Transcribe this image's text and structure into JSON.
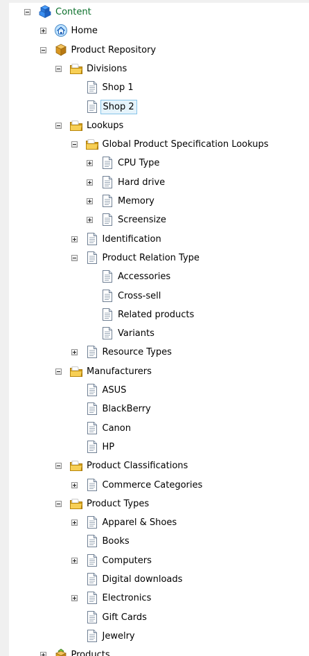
{
  "tree": {
    "nodes": [
      {
        "label": "Content",
        "depth": 0,
        "expander": "minus",
        "icon": "content-icon",
        "highlight": "green",
        "selected": false
      },
      {
        "label": "Home",
        "depth": 1,
        "expander": "plus",
        "icon": "home-icon",
        "selected": false
      },
      {
        "label": "Product Repository",
        "depth": 1,
        "expander": "minus",
        "icon": "box-icon",
        "selected": false
      },
      {
        "label": "Divisions",
        "depth": 2,
        "expander": "minus",
        "icon": "folder-icon",
        "selected": false
      },
      {
        "label": "Shop 1",
        "depth": 3,
        "expander": "none",
        "icon": "document-icon",
        "selected": false
      },
      {
        "label": "Shop 2",
        "depth": 3,
        "expander": "none",
        "icon": "document-icon",
        "selected": true
      },
      {
        "label": "Lookups",
        "depth": 2,
        "expander": "minus",
        "icon": "folder-icon",
        "selected": false
      },
      {
        "label": "Global Product Specification Lookups",
        "depth": 3,
        "expander": "minus",
        "icon": "folder-icon",
        "selected": false
      },
      {
        "label": "CPU Type",
        "depth": 4,
        "expander": "plus",
        "icon": "document-icon",
        "selected": false
      },
      {
        "label": "Hard drive",
        "depth": 4,
        "expander": "plus",
        "icon": "document-icon",
        "selected": false
      },
      {
        "label": "Memory",
        "depth": 4,
        "expander": "plus",
        "icon": "document-icon",
        "selected": false
      },
      {
        "label": "Screensize",
        "depth": 4,
        "expander": "plus",
        "icon": "document-icon",
        "selected": false
      },
      {
        "label": "Identification",
        "depth": 3,
        "expander": "plus",
        "icon": "document-icon",
        "selected": false
      },
      {
        "label": "Product Relation Type",
        "depth": 3,
        "expander": "minus",
        "icon": "document-icon",
        "selected": false
      },
      {
        "label": "Accessories",
        "depth": 4,
        "expander": "none",
        "icon": "document-icon",
        "selected": false
      },
      {
        "label": "Cross-sell",
        "depth": 4,
        "expander": "none",
        "icon": "document-icon",
        "selected": false
      },
      {
        "label": "Related products",
        "depth": 4,
        "expander": "none",
        "icon": "document-icon",
        "selected": false
      },
      {
        "label": "Variants",
        "depth": 4,
        "expander": "none",
        "icon": "document-icon",
        "selected": false
      },
      {
        "label": "Resource Types",
        "depth": 3,
        "expander": "plus",
        "icon": "document-icon",
        "selected": false
      },
      {
        "label": "Manufacturers",
        "depth": 2,
        "expander": "minus",
        "icon": "folder-icon",
        "selected": false
      },
      {
        "label": "ASUS",
        "depth": 3,
        "expander": "none",
        "icon": "document-icon",
        "selected": false
      },
      {
        "label": "BlackBerry",
        "depth": 3,
        "expander": "none",
        "icon": "document-icon",
        "selected": false
      },
      {
        "label": "Canon",
        "depth": 3,
        "expander": "none",
        "icon": "document-icon",
        "selected": false
      },
      {
        "label": "HP",
        "depth": 3,
        "expander": "none",
        "icon": "document-icon",
        "selected": false
      },
      {
        "label": "Product Classifications",
        "depth": 2,
        "expander": "minus",
        "icon": "folder-icon",
        "selected": false
      },
      {
        "label": "Commerce Categories",
        "depth": 3,
        "expander": "plus",
        "icon": "document-icon",
        "selected": false
      },
      {
        "label": "Product Types",
        "depth": 2,
        "expander": "minus",
        "icon": "folder-icon",
        "selected": false
      },
      {
        "label": "Apparel & Shoes",
        "depth": 3,
        "expander": "plus",
        "icon": "document-icon",
        "selected": false
      },
      {
        "label": "Books",
        "depth": 3,
        "expander": "none",
        "icon": "document-icon",
        "selected": false
      },
      {
        "label": "Computers",
        "depth": 3,
        "expander": "plus",
        "icon": "document-icon",
        "selected": false
      },
      {
        "label": "Digital downloads",
        "depth": 3,
        "expander": "none",
        "icon": "document-icon",
        "selected": false
      },
      {
        "label": "Electronics",
        "depth": 3,
        "expander": "plus",
        "icon": "document-icon",
        "selected": false
      },
      {
        "label": "Gift Cards",
        "depth": 3,
        "expander": "none",
        "icon": "document-icon",
        "selected": false
      },
      {
        "label": "Jewelry",
        "depth": 3,
        "expander": "none",
        "icon": "document-icon",
        "selected": false
      },
      {
        "label": "Products",
        "depth": 1,
        "expander": "plus",
        "icon": "products-icon",
        "selected": false
      }
    ]
  },
  "colors": {
    "selection_bg": "#e5f3fb",
    "selection_border": "#86c4e8",
    "content_label": "#0a6f2a",
    "folder": "#f5c542"
  }
}
